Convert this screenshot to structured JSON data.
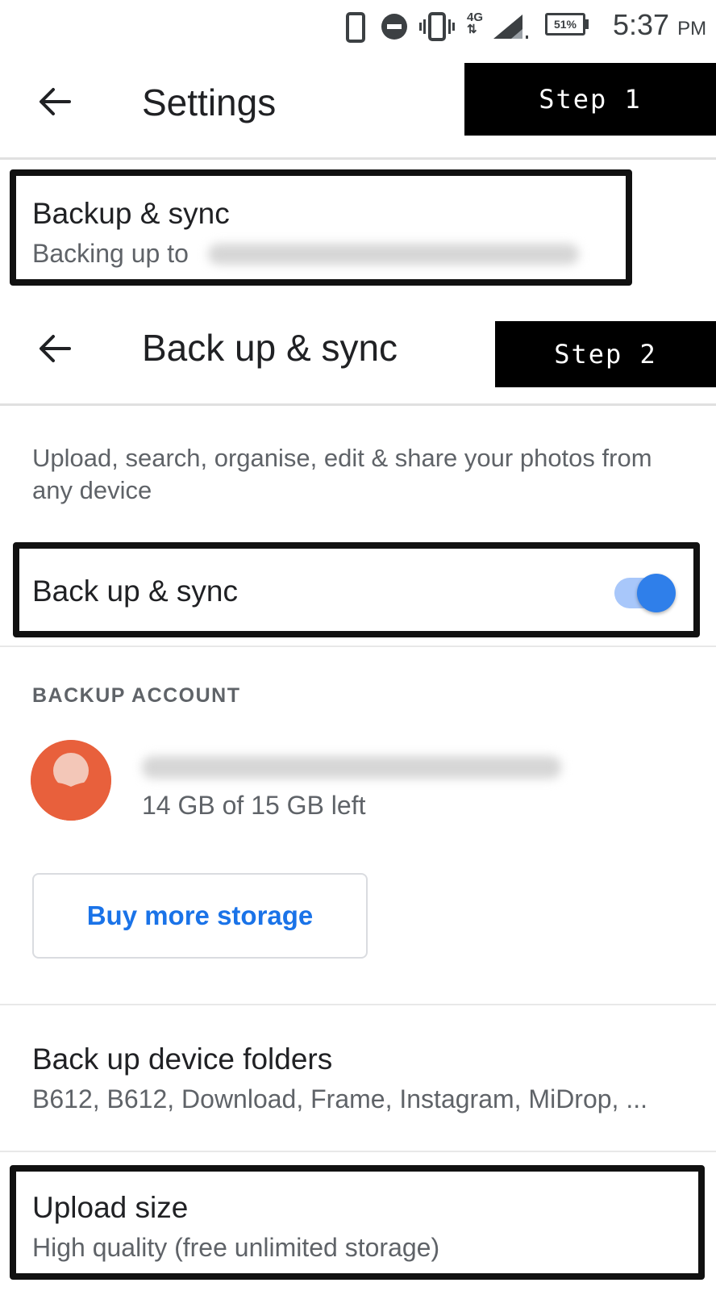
{
  "status_bar": {
    "battery": "51%",
    "network": "4G",
    "time": "5:37",
    "ampm": "PM"
  },
  "step1": {
    "title": "Settings",
    "label": "Step 1"
  },
  "backup_item": {
    "title": "Backup & sync",
    "subtitle": "Backing up to"
  },
  "step2": {
    "title": "Back up & sync",
    "label": "Step 2"
  },
  "description": "Upload, search, organise, edit & share your photos from any device",
  "backup_toggle": {
    "label": "Back up & sync",
    "enabled": true,
    "accent": "#2f7fea"
  },
  "account": {
    "header": "BACKUP ACCOUNT",
    "storage": "14 GB of 15 GB left",
    "avatar_color": "#e8603c"
  },
  "buy_button": "Buy more storage",
  "device_folders": {
    "title": "Back up device folders",
    "subtitle": "B612, B612, Download, Frame, Instagram, MiDrop, ..."
  },
  "upload_size": {
    "title": "Upload size",
    "subtitle": "High quality (free unlimited storage)"
  }
}
